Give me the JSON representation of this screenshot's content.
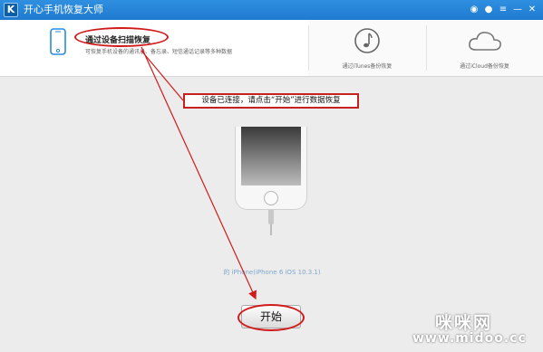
{
  "app": {
    "title": "开心手机恢复大师",
    "logo_letter": "K"
  },
  "window_controls": {
    "icons": [
      "wechat-icon",
      "chat-icon",
      "menu-icon",
      "minimize-icon",
      "close-icon"
    ],
    "glyphs": [
      "◉",
      "●",
      "≡",
      "—",
      "✕"
    ]
  },
  "tabs": [
    {
      "title": "通过设备扫描恢复",
      "description": "可恢复手机设备的通讯录、备忘录、短信通话记录等多种数据",
      "icon": "phone-icon",
      "active": true
    },
    {
      "title": "通过iTunes备份恢复",
      "icon": "music-note-icon",
      "active": false
    },
    {
      "title": "通过iCloud备份恢复",
      "icon": "cloud-icon",
      "active": false
    }
  ],
  "main": {
    "notice": "设备已连接，请点击“开始”进行数据恢复",
    "device_name": "的 iPhone(iPhone 6  iOS 10.3.1)",
    "start_button": "开始"
  },
  "watermark": {
    "line1": "咪咪网",
    "line2": "www.midoo.cc"
  },
  "colors": {
    "accent": "#1f7ad0",
    "annotation": "#d11b1b"
  }
}
